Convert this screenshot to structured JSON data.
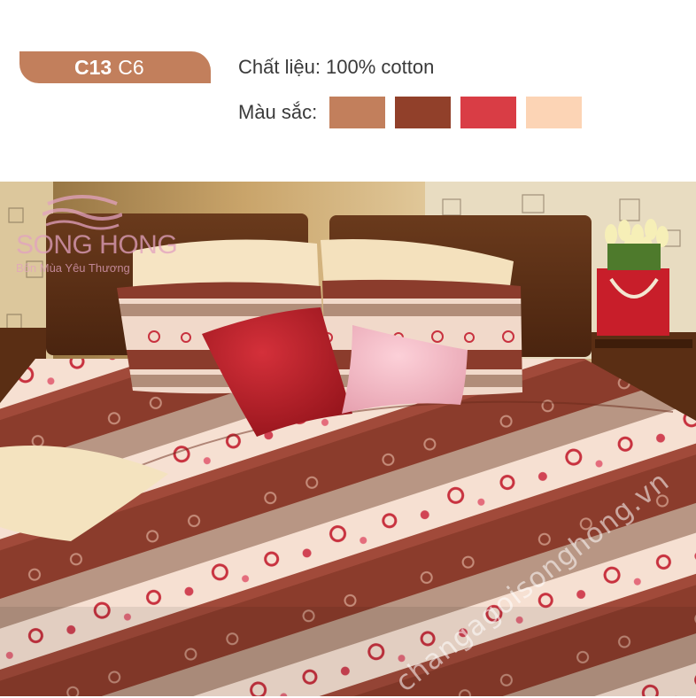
{
  "product": {
    "code": "C13",
    "variant": "C6"
  },
  "specs": {
    "material_label": "Chất liệu: 100% cotton",
    "color_label": "Màu sắc:"
  },
  "color_swatches": [
    "#c27f5c",
    "#91402a",
    "#d93d45",
    "#fcd4b5"
  ],
  "brand": {
    "name": "SONG HONG",
    "slogan": "Bốn Mùa Yêu Thương",
    "color": "#e2a2bf"
  },
  "watermark_url": "changagoisonghong.vn",
  "accent_color": "#c27f5c"
}
